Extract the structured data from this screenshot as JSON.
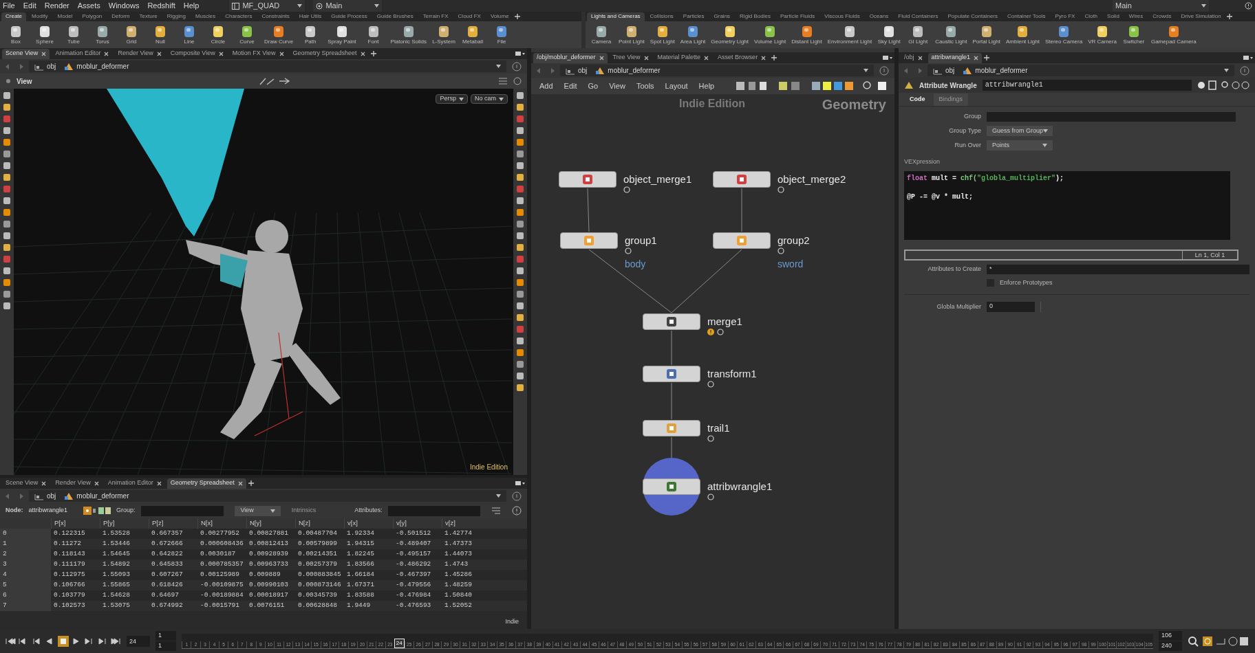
{
  "menu_bar": {
    "items": [
      "File",
      "Edit",
      "Render",
      "Assets",
      "Windows",
      "Redshift",
      "Help"
    ],
    "desktop": "MF_QUAD",
    "context": "Main",
    "right_label": "Main"
  },
  "shelves": [
    {
      "tabs": [
        {
          "label": "Create",
          "selected": true
        },
        {
          "label": "Modify",
          "selected": false
        },
        {
          "label": "Model",
          "selected": false
        },
        {
          "label": "Polygon",
          "selected": false
        },
        {
          "label": "Deform",
          "selected": false
        },
        {
          "label": "Texture",
          "selected": false
        },
        {
          "label": "Rigging",
          "selected": false
        },
        {
          "label": "Muscles",
          "selected": false
        },
        {
          "label": "Characters",
          "selected": false
        },
        {
          "label": "Constraints",
          "selected": false
        },
        {
          "label": "Hair Utils",
          "selected": false
        },
        {
          "label": "Guide Process",
          "selected": false
        },
        {
          "label": "Guide Brushes",
          "selected": false
        },
        {
          "label": "Terrain FX",
          "selected": false
        },
        {
          "label": "Cloud FX",
          "selected": false
        },
        {
          "label": "Volume",
          "selected": false
        }
      ],
      "tools": [
        "Box",
        "Sphere",
        "Tube",
        "Torus",
        "Grid",
        "Null",
        "Line",
        "Circle",
        "Curve",
        "Draw Curve",
        "Path",
        "Spray Paint",
        "Font",
        "Platonic Solids",
        "L-System",
        "Metaball",
        "File"
      ]
    },
    {
      "tabs": [
        {
          "label": "Lights and Cameras",
          "selected": true
        },
        {
          "label": "Collisions",
          "selected": false
        },
        {
          "label": "Particles",
          "selected": false
        },
        {
          "label": "Grains",
          "selected": false
        },
        {
          "label": "Rigid Bodies",
          "selected": false
        },
        {
          "label": "Particle Fluids",
          "selected": false
        },
        {
          "label": "Viscous Fluids",
          "selected": false
        },
        {
          "label": "Oceans",
          "selected": false
        },
        {
          "label": "Fluid Containers",
          "selected": false
        },
        {
          "label": "Populate Containers",
          "selected": false
        },
        {
          "label": "Container Tools",
          "selected": false
        },
        {
          "label": "Pyro FX",
          "selected": false
        },
        {
          "label": "Cloth",
          "selected": false
        },
        {
          "label": "Solid",
          "selected": false
        },
        {
          "label": "Wires",
          "selected": false
        },
        {
          "label": "Crowds",
          "selected": false
        },
        {
          "label": "Drive Simulation",
          "selected": false
        }
      ],
      "tools": [
        "Camera",
        "Point Light",
        "Spot Light",
        "Area Light",
        "Geometry Light",
        "Volume Light",
        "Distant Light",
        "Environment Light",
        "Sky Light",
        "GI Light",
        "Caustic Light",
        "Portal Light",
        "Ambient Light",
        "Stereo Camera",
        "VR Camera",
        "Switcher",
        "Gamepad Camera"
      ]
    }
  ],
  "scene_view": {
    "tabs": [
      {
        "label": "Scene View",
        "selected": true
      },
      {
        "label": "Animation Editor",
        "selected": false
      },
      {
        "label": "Render View",
        "selected": false
      },
      {
        "label": "Composite View",
        "selected": false
      },
      {
        "label": "Motion FX View",
        "selected": false
      },
      {
        "label": "Geometry Spreadsheet",
        "selected": false
      }
    ],
    "path": [
      "obj",
      "moblur_deformer"
    ],
    "view_label": "View",
    "camera_buttons": [
      "Persp",
      "No cam"
    ],
    "edition": "Indie Edition"
  },
  "spreadsheet": {
    "tabs": [
      {
        "label": "Scene View",
        "selected": false
      },
      {
        "label": "Render View",
        "selected": false
      },
      {
        "label": "Animation Editor",
        "selected": false
      },
      {
        "label": "Geometry Spreadsheet",
        "selected": true
      }
    ],
    "path": [
      "obj",
      "moblur_deformer"
    ],
    "node_label": "Node:",
    "node": "attribwrangle1",
    "group_label": "Group:",
    "view_button": "View",
    "intrinsics_button": "Intrinsics",
    "attributes_label": "Attributes:",
    "columns": [
      "P[x]",
      "P[y]",
      "P[z]",
      "N[x]",
      "N[y]",
      "N[z]",
      "v[x]",
      "v[y]",
      "v[z]"
    ],
    "rows": [
      {
        "index": "0",
        "cells": [
          "0.122315",
          "1.53528",
          "0.667357",
          "0.00277952",
          "0.00827881",
          "0.00487704",
          "1.92334",
          "-0.501512",
          "1.42774"
        ]
      },
      {
        "index": "1",
        "cells": [
          "0.11272",
          "1.53446",
          "0.672666",
          "0.000608436",
          "0.00812413",
          "0.00579899",
          "1.94315",
          "-0.489407",
          "1.47373"
        ]
      },
      {
        "index": "2",
        "cells": [
          "0.118143",
          "1.54645",
          "0.642822",
          "0.0030187",
          "0.00928939",
          "0.00214351",
          "1.82245",
          "-0.495157",
          "1.44073"
        ]
      },
      {
        "index": "3",
        "cells": [
          "0.111179",
          "1.54892",
          "0.645833",
          "0.000785357",
          "0.00963733",
          "0.00257379",
          "1.83566",
          "-0.486292",
          "1.4743"
        ]
      },
      {
        "index": "4",
        "cells": [
          "0.112975",
          "1.55093",
          "0.607267",
          "0.00125989",
          "0.009889",
          "0.000883845",
          "1.66184",
          "-0.467397",
          "1.45286"
        ]
      },
      {
        "index": "5",
        "cells": [
          "0.106766",
          "1.55865",
          "0.618426",
          "-0.00109875",
          "0.00990103",
          "0.000873146",
          "1.67371",
          "-0.479556",
          "1.48259"
        ]
      },
      {
        "index": "6",
        "cells": [
          "0.103779",
          "1.54628",
          "0.64697",
          "-0.00189884",
          "0.00018917",
          "0.00345739",
          "1.83588",
          "-0.476984",
          "1.50840"
        ]
      },
      {
        "index": "7",
        "cells": [
          "0.102573",
          "1.53075",
          "0.674992",
          "-0.0015791",
          "0.0076151",
          "0.00628848",
          "1.9449",
          "-0.476593",
          "1.52052"
        ]
      }
    ],
    "edition": "Indie"
  },
  "network": {
    "tabs": [
      {
        "label": "/obj/moblur_deformer",
        "selected": true
      },
      {
        "label": "Tree View",
        "selected": false
      },
      {
        "label": "Material Palette",
        "selected": false
      },
      {
        "label": "Asset Browser",
        "selected": false
      }
    ],
    "path": [
      "obj",
      "moblur_deformer"
    ],
    "menu": [
      "Add",
      "Edit",
      "Go",
      "View",
      "Tools",
      "Layout",
      "Help"
    ],
    "edition": "Indie Edition",
    "context": "Geometry",
    "nodes": [
      {
        "name": "object_merge1",
        "selected": false,
        "warning": false
      },
      {
        "name": "object_merge2",
        "selected": false,
        "warning": false
      },
      {
        "name": "group1",
        "group_name": "body",
        "selected": false,
        "warning": false
      },
      {
        "name": "group2",
        "group_name": "sword",
        "selected": false,
        "warning": false
      },
      {
        "name": "merge1",
        "selected": false,
        "warning": true
      },
      {
        "name": "transform1",
        "selected": false,
        "warning": false
      },
      {
        "name": "trail1",
        "selected": false,
        "warning": false
      },
      {
        "name": "attribwrangle1",
        "selected": true,
        "warning": false
      }
    ]
  },
  "parameters": {
    "tabs": [
      {
        "label": "/obj",
        "selected": false
      },
      {
        "label": "attribwrangle1",
        "selected": true
      }
    ],
    "path": [
      "obj",
      "moblur_deformer"
    ],
    "node_type": "Attribute Wrangle",
    "node_name": "attribwrangle1",
    "subtabs": [
      {
        "label": "Code",
        "selected": true
      },
      {
        "label": "Bindings",
        "selected": false
      }
    ],
    "fields": [
      {
        "label": "Group",
        "kind": "text"
      },
      {
        "label": "Group Type",
        "kind": "menu",
        "value": "Guess from Group"
      },
      {
        "label": "Run Over",
        "kind": "menu",
        "value": "Points"
      }
    ],
    "code_label": "VEXpression",
    "code_lines": [
      {
        "spaced": false,
        "tokens": [
          {
            "text": "float",
            "kind": "keyword"
          },
          {
            "text": " mult = ",
            "kind": "plain"
          },
          {
            "text": "chf(",
            "kind": "function"
          },
          {
            "text": "\"globla_multiplier\"",
            "kind": "string"
          },
          {
            "text": ");",
            "kind": "plain"
          }
        ]
      },
      {
        "spaced": true,
        "tokens": [
          {
            "text": "@P -= @v * mult;",
            "kind": "plain"
          }
        ]
      }
    ],
    "cursor_status": "Ln 1, Col 1",
    "attributes_label": "Attributes to Create",
    "attributes_value": "*",
    "enforce_label": "Enforce Prototypes",
    "enforce_checked": false,
    "multiplier_label": "Globla Multiplier",
    "multiplier_value": "0"
  },
  "timeline": {
    "frame": "24",
    "start": [
      "1",
      "1"
    ],
    "ticks_before": [
      "1",
      "2",
      "3",
      "4",
      "5",
      "6",
      "7",
      "8",
      "9",
      "10",
      "11",
      "12",
      "13",
      "14",
      "15",
      "16",
      "17",
      "18",
      "19",
      "20",
      "21",
      "22",
      "23"
    ],
    "current": "24",
    "ticks_after": [
      "25",
      "26",
      "27",
      "28",
      "29",
      "30",
      "31",
      "32",
      "33",
      "34",
      "35",
      "36",
      "37",
      "38",
      "39",
      "40",
      "41",
      "42",
      "43",
      "44",
      "45",
      "46",
      "47",
      "48",
      "49",
      "50",
      "51",
      "52",
      "53",
      "54",
      "55",
      "56",
      "57",
      "58",
      "59",
      "60",
      "61",
      "62",
      "63",
      "64",
      "65",
      "66",
      "67",
      "68",
      "69",
      "70",
      "71",
      "72",
      "73",
      "74",
      "75",
      "76",
      "77",
      "78",
      "79",
      "80",
      "81",
      "82",
      "83",
      "84",
      "85",
      "86",
      "87",
      "88",
      "89",
      "90",
      "91",
      "92",
      "93",
      "94",
      "95",
      "96",
      "97",
      "98",
      "99",
      "100",
      "101",
      "102",
      "103",
      "104",
      "105"
    ],
    "end": [
      "106",
      "240"
    ]
  }
}
